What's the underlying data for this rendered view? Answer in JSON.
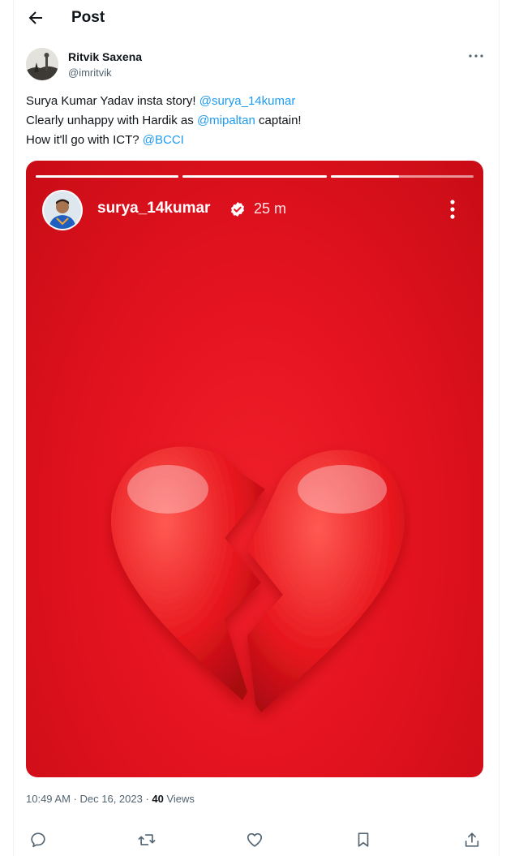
{
  "header": {
    "title": "Post",
    "back_icon": "arrow-left-icon"
  },
  "author": {
    "name": "Ritvik Saxena",
    "handle": "@imritvik"
  },
  "tweet": {
    "line1_text": "Surya Kumar Yadav insta story! ",
    "line1_mention": "@surya_14kumar",
    "line2_text": "Clearly unhappy with Hardik as ",
    "line2_mention": "@mipaltan",
    "line2_suffix": " captain!",
    "line3_text": "How it'll go with ICT? ",
    "line3_mention": "@BCCI"
  },
  "story": {
    "username": "surya_14kumar",
    "time": "25 m",
    "progress_fill": [
      1,
      1,
      0.48
    ],
    "background_color": "#e51320"
  },
  "meta": {
    "time": "10:49 AM",
    "sep1": " · ",
    "date": "Dec 16, 2023",
    "sep2": " · ",
    "views_count": "40",
    "views_label": " Views"
  },
  "actions": [
    "reply-icon",
    "repost-icon",
    "like-icon",
    "bookmark-icon",
    "share-icon"
  ],
  "colors": {
    "accent": "#1d9bf0",
    "text": "#0f1419",
    "muted": "#536471"
  }
}
